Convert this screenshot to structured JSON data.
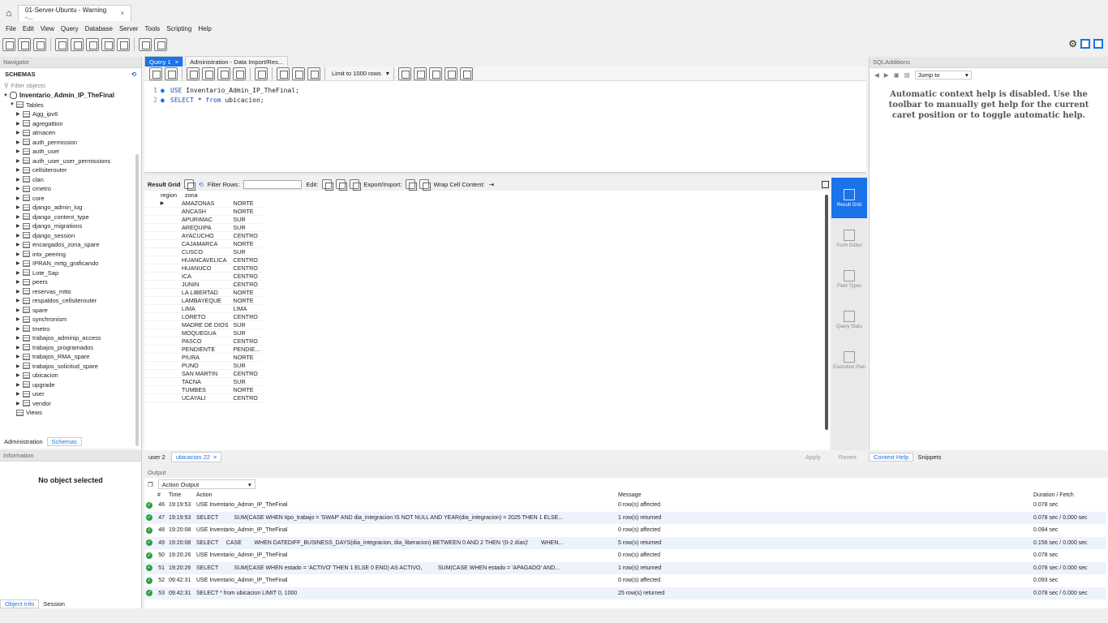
{
  "window": {
    "tab_title": "01-Server-Ubuntu - Warning -...",
    "close": "×"
  },
  "menu": [
    "File",
    "Edit",
    "View",
    "Query",
    "Database",
    "Server",
    "Tools",
    "Scripting",
    "Help"
  ],
  "navigator": {
    "title": "Navigator",
    "schemas_label": "SCHEMAS",
    "filter_placeholder": "Filter objects",
    "db_name": "Inventario_Admin_IP_TheFinal",
    "tables_label": "Tables",
    "tables": [
      "Agg_ipv6",
      "agregattion",
      "almacen",
      "auth_permission",
      "auth_user",
      "auth_user_user_permissions",
      "cellsiterouter",
      "clan",
      "cmetro",
      "core",
      "django_admin_log",
      "django_content_type",
      "django_migrations",
      "django_session",
      "encargados_zona_spare",
      "intx_peering",
      "IPRAN_mrtg_graficando",
      "Lote_Sap",
      "peers",
      "reservas_mtto",
      "respaldos_cellsiterouter",
      "spare",
      "synchronism",
      "tmetro",
      "trabajos_adminip_access",
      "trabajos_programados",
      "trabajos_RMA_spare",
      "trabajos_solicitud_spare",
      "ubicacion",
      "upgrade",
      "user",
      "vendor"
    ],
    "views_label": "Views",
    "tab_admin": "Administration",
    "tab_schemas": "Schemas"
  },
  "info": {
    "title": "Information",
    "message": "No object selected",
    "tab_objinfo": "Object Info",
    "tab_session": "Session"
  },
  "editor": {
    "tab_query": "Query 1",
    "tab_admin": "Administration - Data Import/Res...",
    "limit_label": "Limit to 1000 rows",
    "lines": [
      {
        "num": "1",
        "kw": "USE",
        "rest": " Inventario_Admin_IP_TheFinal;"
      },
      {
        "num": "2",
        "kw": "SELECT",
        "rest": " * ",
        "kw2": "from",
        "rest2": " ubicacion;"
      }
    ]
  },
  "result": {
    "grid_label": "Result Grid",
    "filter_label": "Filter Rows:",
    "edit_label": "Edit:",
    "export_label": "Export/Import:",
    "wrap_label": "Wrap Cell Content:",
    "columns": [
      "region",
      "zona"
    ],
    "rows": [
      [
        "AMAZONAS",
        "NORTE"
      ],
      [
        "ANCASH",
        "NORTE"
      ],
      [
        "APURIMAC",
        "SUR"
      ],
      [
        "AREQUIPA",
        "SUR"
      ],
      [
        "AYACUCHO",
        "CENTRO"
      ],
      [
        "CAJAMARCA",
        "NORTE"
      ],
      [
        "CUSCO",
        "SUR"
      ],
      [
        "HUANCAVELICA",
        "CENTRO"
      ],
      [
        "HUANUCO",
        "CENTRO"
      ],
      [
        "ICA",
        "CENTRO"
      ],
      [
        "JUNIN",
        "CENTRO"
      ],
      [
        "LA LIBERTAD",
        "NORTE"
      ],
      [
        "LAMBAYEQUE",
        "NORTE"
      ],
      [
        "LIMA",
        "LIMA"
      ],
      [
        "LORETO",
        "CENTRO"
      ],
      [
        "MADRE DE DIOS",
        "SUR"
      ],
      [
        "MOQUEGUA",
        "SUR"
      ],
      [
        "PASCO",
        "CENTRO"
      ],
      [
        "PENDIENTE",
        "PENDIE..."
      ],
      [
        "PIURA",
        "NORTE"
      ],
      [
        "PUNO",
        "SUR"
      ],
      [
        "SAN MARTIN",
        "CENTRO"
      ],
      [
        "TACNA",
        "SUR"
      ],
      [
        "TUMBES",
        "NORTE"
      ],
      [
        "UCAYALI",
        "CENTRO"
      ]
    ],
    "side": [
      "Result Grid",
      "Form Editor",
      "Field Types",
      "Query Stats",
      "Execution Plan"
    ],
    "tab_user": "user 2",
    "tab_ubic": "ubicacion 22",
    "apply": "Apply",
    "revert": "Revert"
  },
  "sqladd": {
    "title": "SQLAdditions",
    "jump": "Jump to",
    "help": "Automatic context help is disabled. Use the toolbar to manually get help for the current caret position or to toggle automatic help.",
    "tab_help": "Context Help",
    "tab_snip": "Snippets"
  },
  "output": {
    "title": "Output",
    "selector": "Action Output",
    "headers": [
      "#",
      "Time",
      "Action",
      "Message",
      "Duration / Fetch"
    ],
    "rows": [
      [
        "46",
        "19:19:53",
        "USE Inventario_Admin_IP_TheFinal",
        "0 row(s) affected",
        "0.078 sec"
      ],
      [
        "47",
        "19:19:53",
        "SELECT          SUM(CASE WHEN tipo_trabajo = 'SWAP' AND dia_integracion IS NOT NULL AND YEAR(dia_integracion) = 2025 THEN 1 ELSE...",
        "1 row(s) returned",
        "0.078 sec / 0.000 sec"
      ],
      [
        "48",
        "19:20:08",
        "USE Inventario_Admin_IP_TheFinal",
        "0 row(s) affected",
        "0.094 sec"
      ],
      [
        "49",
        "19:20:08",
        "SELECT     CASE        WHEN DATEDIFF_BUSINESS_DAYS(dia_integracion, dia_liberacion) BETWEEN 0 AND 2 THEN '(0-2 días)'        WHEN...",
        "5 row(s) returned",
        "0.156 sec / 0.000 sec"
      ],
      [
        "50",
        "19:20:26",
        "USE Inventario_Admin_IP_TheFinal",
        "0 row(s) affected",
        "0.078 sec"
      ],
      [
        "51",
        "19:20:26",
        "SELECT          SUM(CASE WHEN estado = 'ACTIVO' THEN 1 ELSE 0 END) AS ACTIVO,          SUM(CASE WHEN estado = 'APAGADO' AND...",
        "1 row(s) returned",
        "0.078 sec / 0.000 sec"
      ],
      [
        "52",
        "09:42:31",
        "USE Inventario_Admin_IP_TheFinal",
        "0 row(s) affected",
        "0.093 sec"
      ],
      [
        "53",
        "09:42:31",
        "SELECT * from ubicacion LIMIT 0, 1000",
        "25 row(s) returned",
        "0.078 sec / 0.000 sec"
      ]
    ]
  }
}
